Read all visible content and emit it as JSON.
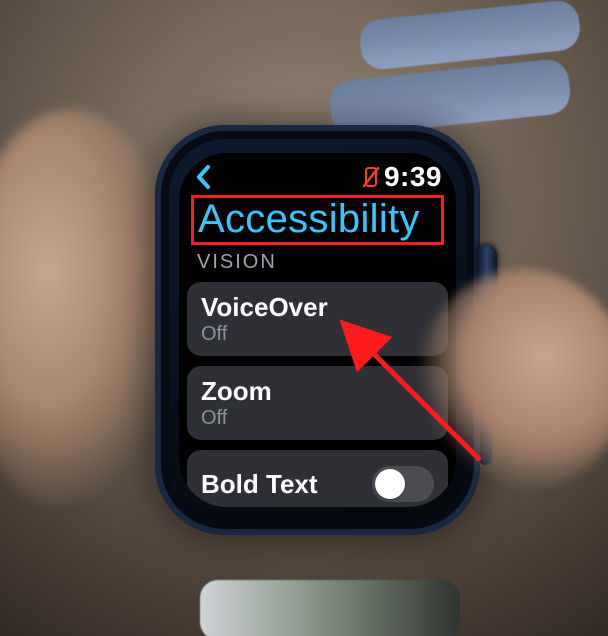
{
  "status": {
    "back_icon": "chevron-left",
    "phone_disconnected": true,
    "time": "9:39"
  },
  "title": "Accessibility",
  "section_header": "VISION",
  "items": [
    {
      "label": "VoiceOver",
      "state": "Off"
    },
    {
      "label": "Zoom",
      "state": "Off"
    }
  ],
  "toggle_item": {
    "label": "Bold Text",
    "on": false
  },
  "annotation": {
    "title_highlight_color": "#ff1b1b",
    "arrow_target": "VoiceOver"
  }
}
